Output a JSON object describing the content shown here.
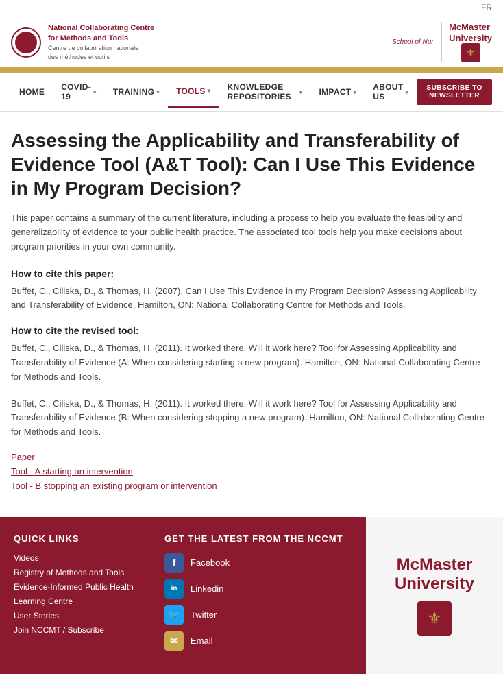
{
  "lang": "FR",
  "header": {
    "logo_brand": "National Collaborating Centre\nfor Methods and Tools",
    "logo_sub": "Centre de collaboration nationale\ndes méthodes et outils",
    "school_label": "School of Nursing",
    "mcmaster_label": "McMaster\nUniversity"
  },
  "nav": {
    "items": [
      {
        "id": "home",
        "label": "HOME",
        "has_chevron": false,
        "active": false
      },
      {
        "id": "covid",
        "label": "COVID-19",
        "has_chevron": true,
        "active": false
      },
      {
        "id": "training",
        "label": "TRAINING",
        "has_chevron": true,
        "active": false
      },
      {
        "id": "tools",
        "label": "TOOLS",
        "has_chevron": true,
        "active": true
      },
      {
        "id": "knowledge",
        "label": "KNOWLEDGE REPOSITORIES",
        "has_chevron": true,
        "active": false
      },
      {
        "id": "impact",
        "label": "IMPACT",
        "has_chevron": true,
        "active": false
      },
      {
        "id": "about",
        "label": "ABOUT US",
        "has_chevron": true,
        "active": false
      }
    ],
    "subscribe_label": "SUBSCRIBE TO NEWSLETTER"
  },
  "main": {
    "title": "Assessing the Applicability and Transferability of Evidence Tool (A&T Tool): Can I Use This Evidence in My Program Decision?",
    "description": "This paper contains a summary of the current literature, including a process to help you evaluate the feasibility and generalizability of evidence to your public health practice. The associated tool tools help you make decisions about program priorities in your own community.",
    "cite_paper_heading": "How to cite this paper:",
    "cite_paper_text": "Buffet, C., Ciliska, D., & Thomas, H. (2007). Can I Use This Evidence in my Program Decision? Assessing Applicability and Transferability of Evidence. Hamilton, ON: National Collaborating Centre for Methods and Tools.",
    "cite_tool_heading": "How to cite the revised tool:",
    "cite_tool_a_text": "Buffet, C., Ciliska, D., & Thomas, H. (2011). It worked there. Will it work here? Tool for Assessing Applicability and Transferability of Evidence (A: When considering starting a new program). Hamilton, ON: National Collaborating Centre for Methods and Tools.",
    "cite_tool_b_text": "Buffet, C., Ciliska, D., & Thomas, H. (2011). It worked there. Will it work here? Tool for Assessing Applicability and Transferability of Evidence (B: When considering stopping a new program). Hamilton, ON: National Collaborating Centre for Methods and Tools.",
    "link_paper": "Paper",
    "link_tool_a": "Tool - A starting an intervention",
    "link_tool_b": "Tool - B stopping an existing program or intervention"
  },
  "footer": {
    "quick_links_heading": "QUICK LINKS",
    "quick_links": [
      "Videos",
      "Registry of Methods and Tools",
      "Evidence-Informed Public Health",
      "Learning Centre",
      "User Stories",
      "Join NCCMT / Subscribe"
    ],
    "latest_heading": "GET THE LATEST FROM THE NCCMT",
    "social_items": [
      {
        "icon": "f",
        "label": "Facebook",
        "type": "fb"
      },
      {
        "icon": "in",
        "label": "Linkedin",
        "type": "li"
      },
      {
        "icon": "🐦",
        "label": "Twitter",
        "type": "tw"
      },
      {
        "icon": "✉",
        "label": "Email",
        "type": "em"
      }
    ],
    "mcmaster_text": "McMaster\nUniversity"
  }
}
